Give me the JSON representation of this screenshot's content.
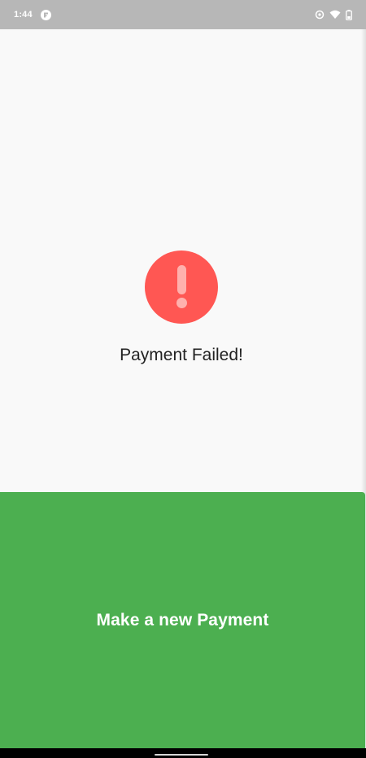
{
  "status_bar": {
    "time": "1:44",
    "app_badge_icon": "app-notification-icon",
    "icons": [
      "sync-icon",
      "wifi-icon",
      "battery-icon"
    ]
  },
  "main": {
    "status_icon": "error-exclamation-icon",
    "status_message": "Payment Failed!"
  },
  "action": {
    "label": "Make a new Payment"
  },
  "colors": {
    "status_bar": "#b7b7b7",
    "background": "#f9f9f9",
    "error_circle": "#ff5753",
    "error_mark": "#ffb1ad",
    "action_panel": "#4caf50",
    "text": "#222222"
  }
}
